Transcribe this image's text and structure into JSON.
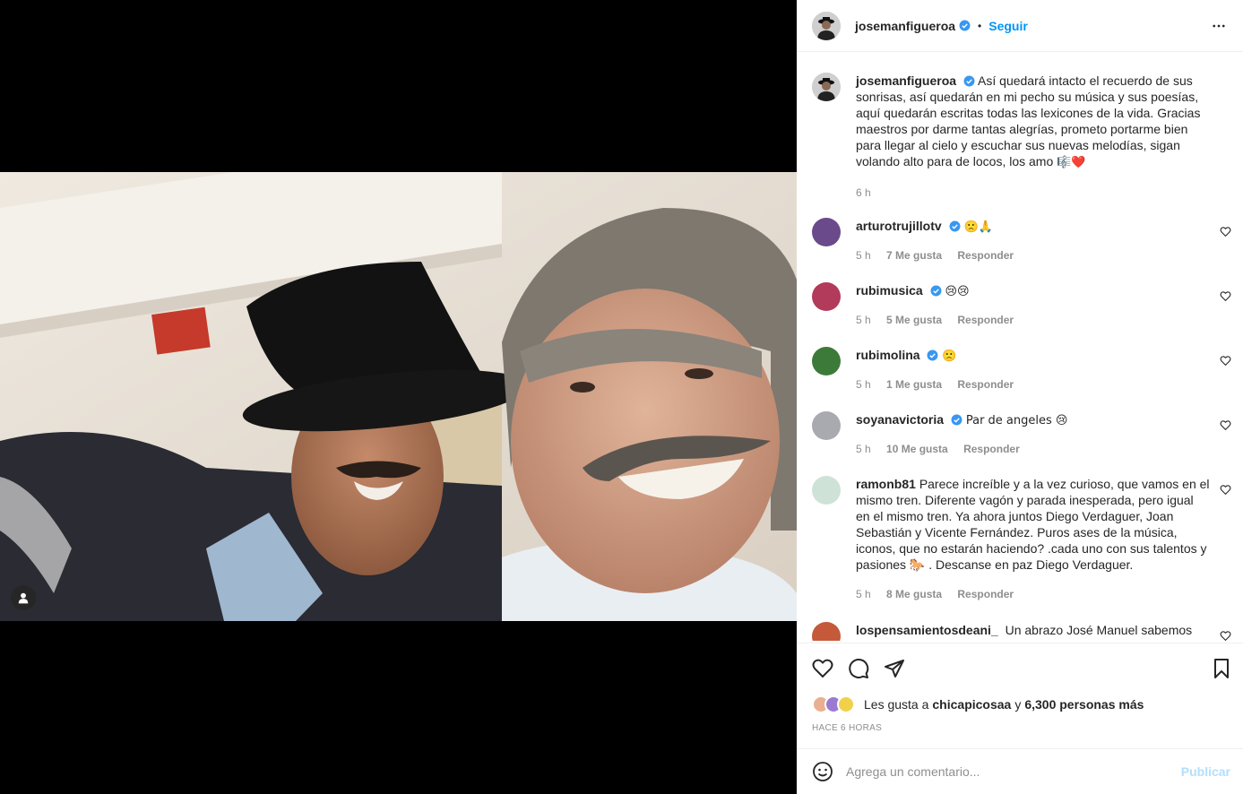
{
  "post": {
    "username": "josemanfigueroa",
    "follow_label": "Seguir",
    "dot": "•",
    "caption_user": "josemanfigueroa",
    "caption": "Así quedará intacto el recuerdo de sus sonrisas, así quedarán en mi pecho su música y sus poesías, aquí quedarán escritas todas las lexicones de la vida. Gracias maestros por darme tantas alegrías, prometo portarme bien para llegar al cielo y escuchar sus nuevas melodías, sigan volando alto para de locos, los amo",
    "caption_emoji": "🎼❤️",
    "caption_time": "6 h"
  },
  "comments": [
    {
      "user": "arturotrujillotv",
      "verified": true,
      "text": "🙁🙏",
      "time": "5 h",
      "likes": "7 Me gusta",
      "reply": "Responder"
    },
    {
      "user": "rubimusica",
      "verified": true,
      "text": "😢😢",
      "time": "5 h",
      "likes": "5 Me gusta",
      "reply": "Responder"
    },
    {
      "user": "rubimolina",
      "verified": true,
      "text": "🙁",
      "time": "5 h",
      "likes": "1 Me gusta",
      "reply": "Responder"
    },
    {
      "user": "soyanavictoria",
      "verified": true,
      "text": "Par de angeles 😢",
      "time": "5 h",
      "likes": "10 Me gusta",
      "reply": "Responder"
    },
    {
      "user": "ramonb81",
      "verified": false,
      "text": "Parece increíble y a la vez curioso, que vamos en el mismo tren. Diferente vagón y parada inesperada, pero igual en el mismo tren. Ya ahora juntos Diego Verdaguer, Joan Sebastián y Vicente Fernández. Puros ases de la música, iconos, que no estarán haciendo? .cada uno con sus talentos y pasiones 🐎 . Descanse en paz Diego Verdaguer.",
      "time": "5 h",
      "likes": "8 Me gusta",
      "reply": "Responder"
    },
    {
      "user": "lospensamientosdeani_",
      "verified": false,
      "text": "Un abrazo José Manuel sabemos eran",
      "time": "",
      "likes": "",
      "reply": ""
    }
  ],
  "likes": {
    "prefix": "Les gusta a",
    "user": "chicapicosaa",
    "connector": "y",
    "count": "6,300 personas más"
  },
  "time_ago": "HACE 6 HORAS",
  "add_comment": {
    "placeholder": "Agrega un comentario...",
    "publish": "Publicar"
  },
  "colors": {
    "link": "#0095f6",
    "publish_disabled": "#b2dffc",
    "muted": "#8e8e8e",
    "verified": "#3897f0"
  }
}
